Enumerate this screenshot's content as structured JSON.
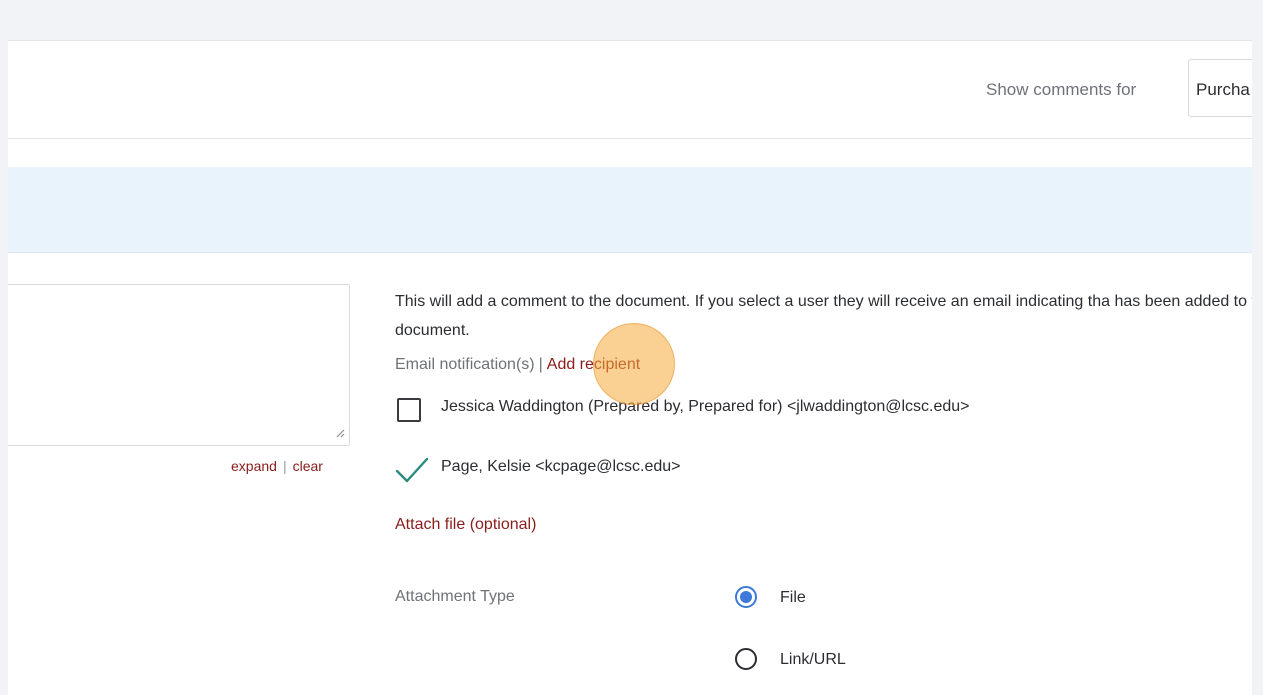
{
  "header": {
    "show_comments_label": "Show comments for",
    "comments_filter_value": "Purcha"
  },
  "comment_editor": {
    "expand_label": "expand",
    "separator": "|",
    "clear_label": "clear"
  },
  "info": {
    "message": "This will add a comment to the document. If you select a user they will receive an email indicating tha has been added to the document."
  },
  "notifications": {
    "label": "Email notification(s)",
    "separator": "|",
    "add_recipient_label": "Add recipient",
    "recipients": [
      {
        "label": "Jessica Waddington (Prepared by, Prepared for) <jlwaddington@lcsc.edu>",
        "checked": false
      },
      {
        "label": "Page, Kelsie <kcpage@lcsc.edu>",
        "checked": true
      }
    ]
  },
  "attachment": {
    "attach_link": "Attach file (optional)",
    "type_label": "Attachment Type",
    "options": [
      {
        "label": "File",
        "selected": true
      },
      {
        "label": "Link/URL",
        "selected": false
      }
    ]
  },
  "colors": {
    "accent_link": "#8a1c1c",
    "radio_selected": "#3c79d8",
    "check_mark": "#2a8a7f",
    "band": "#e9f3fb",
    "click_highlight": "#f6a93a"
  }
}
